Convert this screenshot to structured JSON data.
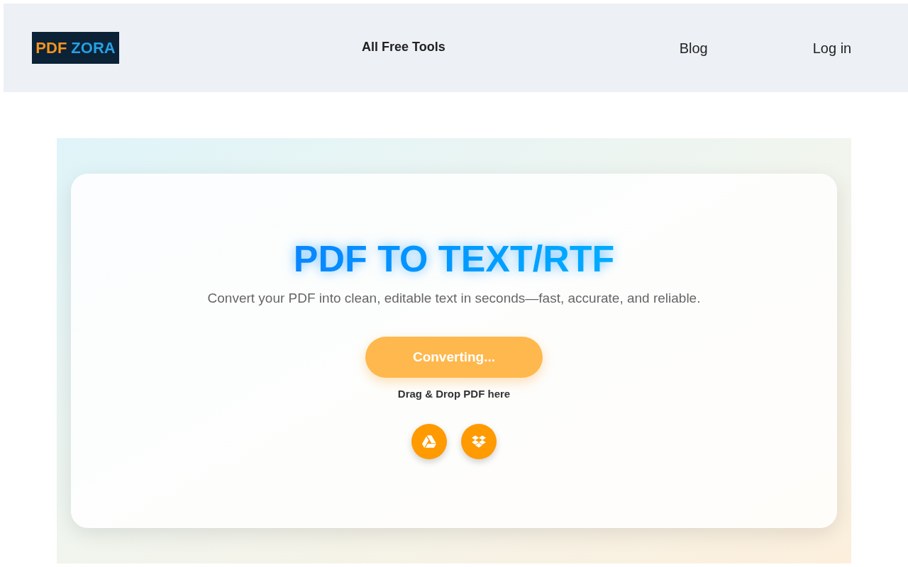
{
  "header": {
    "logo": {
      "part_1": "PDF",
      "part_2": "ZORA"
    },
    "center_link": "All Free Tools",
    "right_links": [
      "Blog",
      "Log in"
    ]
  },
  "hero": {
    "title": "PDF TO TEXT/RTF",
    "subtitle": "Convert your PDF into clean, editable text in seconds—fast, accurate, and reliable.",
    "convert_button": {
      "label": "Converting..."
    },
    "drop_hint": "Drag & Drop PDF here",
    "source_buttons": [
      {
        "kind": "google_drive"
      },
      {
        "kind": "dropbox"
      }
    ]
  }
}
